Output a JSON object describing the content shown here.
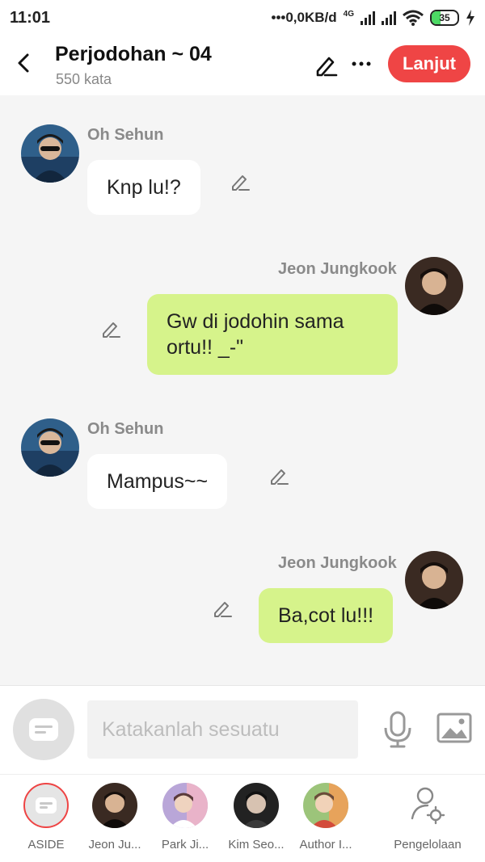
{
  "status": {
    "time": "11:01",
    "speed": "•••0,0KB/d",
    "network": "4G",
    "battery": "35",
    "battery_level": 0.35
  },
  "header": {
    "title": "Perjodohan ~ 04",
    "subtitle": "550 kata",
    "next_label": "Lanjut"
  },
  "messages": [
    {
      "sender": "Oh Sehun",
      "text": "Knp lu!?",
      "side": "left"
    },
    {
      "sender": "Jeon Jungkook",
      "text": "Gw di jodohin sama ortu!! _-\"",
      "side": "right"
    },
    {
      "sender": "Oh Sehun",
      "text": "Mampus~~",
      "side": "left"
    },
    {
      "sender": "Jeon Jungkook",
      "text": "Ba,cot lu!!!",
      "side": "right"
    }
  ],
  "composer": {
    "placeholder": "Katakanlah sesuatu"
  },
  "tabs": [
    {
      "label": "ASIDE"
    },
    {
      "label": "Jeon Ju..."
    },
    {
      "label": "Park Ji..."
    },
    {
      "label": "Kim Seo..."
    },
    {
      "label": "Author I..."
    },
    {
      "label": "Pengelolaan"
    }
  ],
  "colors": {
    "accent": "#ef4545",
    "right_bubble": "#d6f38b",
    "left_bubble": "#ffffff",
    "background": "#f5f5f5"
  }
}
